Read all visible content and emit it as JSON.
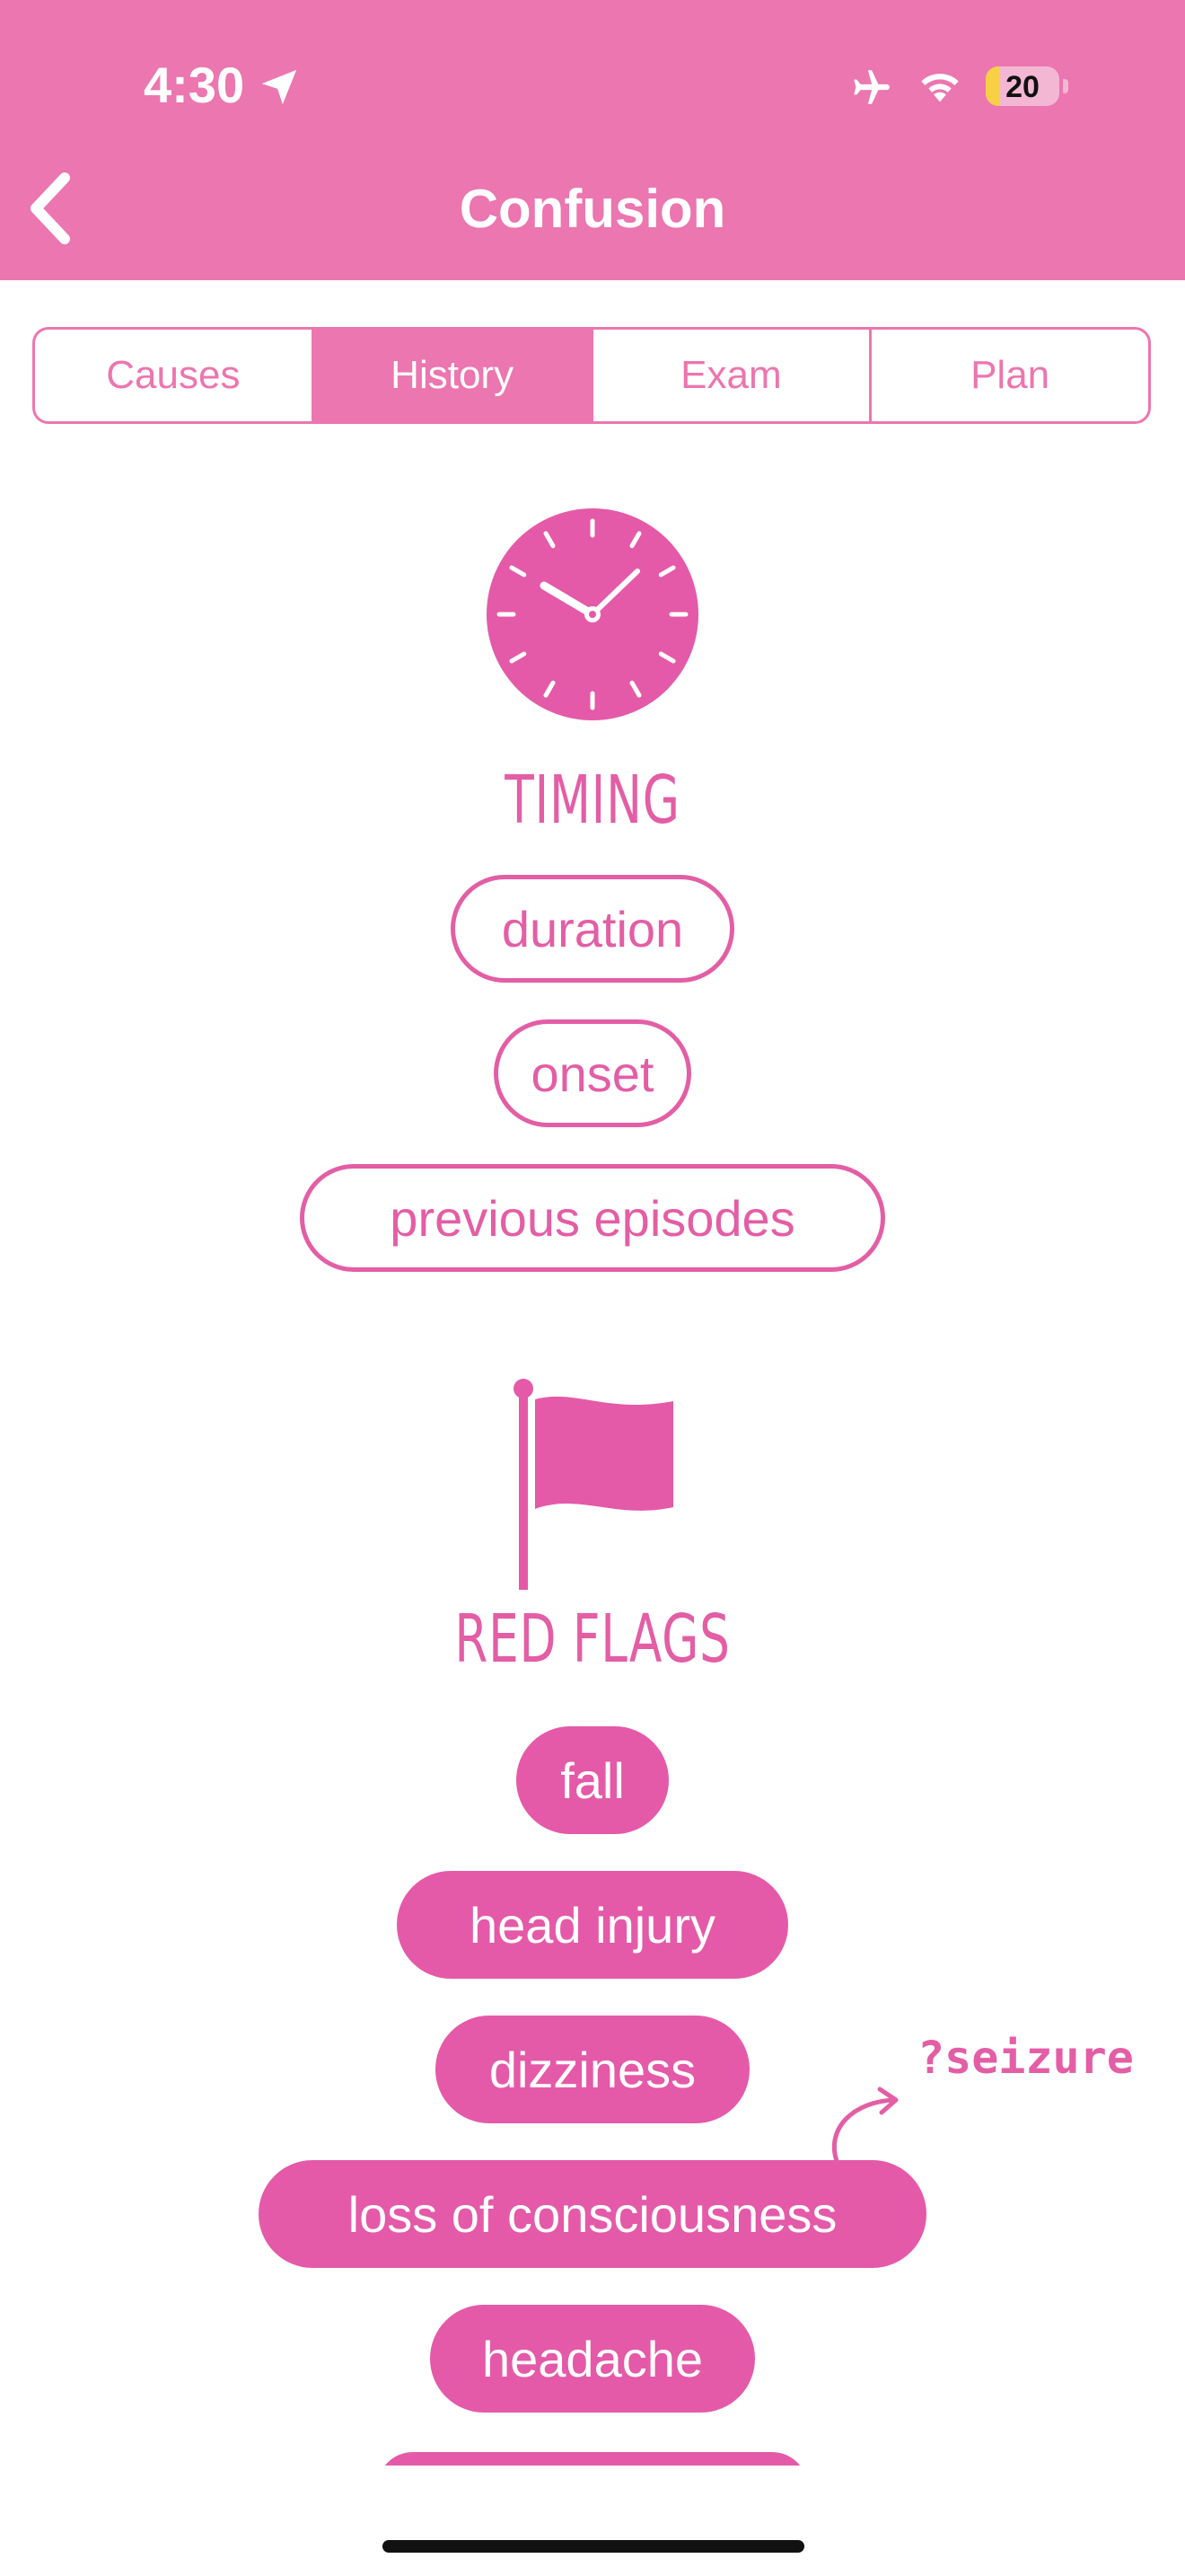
{
  "status_bar": {
    "time": "4:30",
    "battery": "20"
  },
  "nav": {
    "title": "Confusion"
  },
  "tabs": [
    {
      "label": "Causes",
      "active": false
    },
    {
      "label": "History",
      "active": true
    },
    {
      "label": "Exam",
      "active": false
    },
    {
      "label": "Plan",
      "active": false
    }
  ],
  "timing": {
    "heading": "TIMING",
    "items": [
      "duration",
      "onset",
      "previous episodes"
    ]
  },
  "red_flags": {
    "heading": "RED FLAGS",
    "items": [
      "fall",
      "head injury",
      "dizziness",
      "loss of consciousness",
      "headache"
    ]
  },
  "annotation": "?seizure",
  "colors": {
    "header": "#EC76AF",
    "accent": "#E35EA5",
    "pill_fill": "#E45AA8"
  }
}
